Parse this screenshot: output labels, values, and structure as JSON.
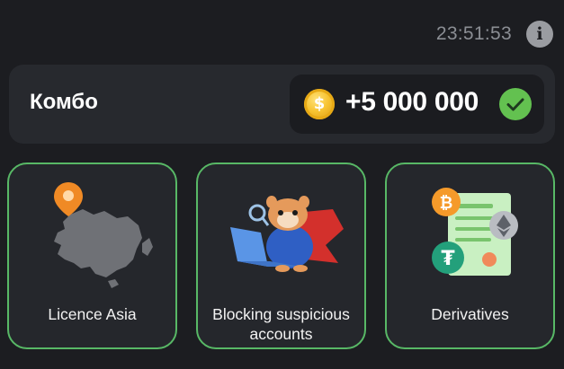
{
  "header": {
    "timer": "23:51:53",
    "info_icon": "info-icon"
  },
  "combo": {
    "title": "Комбо",
    "reward_amount": "+5 000 000",
    "coin_symbol": "$",
    "coin_icon": "coin-icon",
    "status_icon": "check-circle-icon"
  },
  "cards": [
    {
      "label": "Licence Asia",
      "icon": "asia-map-pin-icon"
    },
    {
      "label": "Blocking suspicious accounts",
      "icon": "hamster-hero-laptop-icon"
    },
    {
      "label": "Derivatives",
      "icon": "crypto-document-icon"
    }
  ],
  "colors": {
    "background": "#1c1d21",
    "card": "#25272c",
    "card_border": "#58b866",
    "check": "#63c150",
    "coin": "#f7c331",
    "timer_text": "#8b8e94"
  }
}
